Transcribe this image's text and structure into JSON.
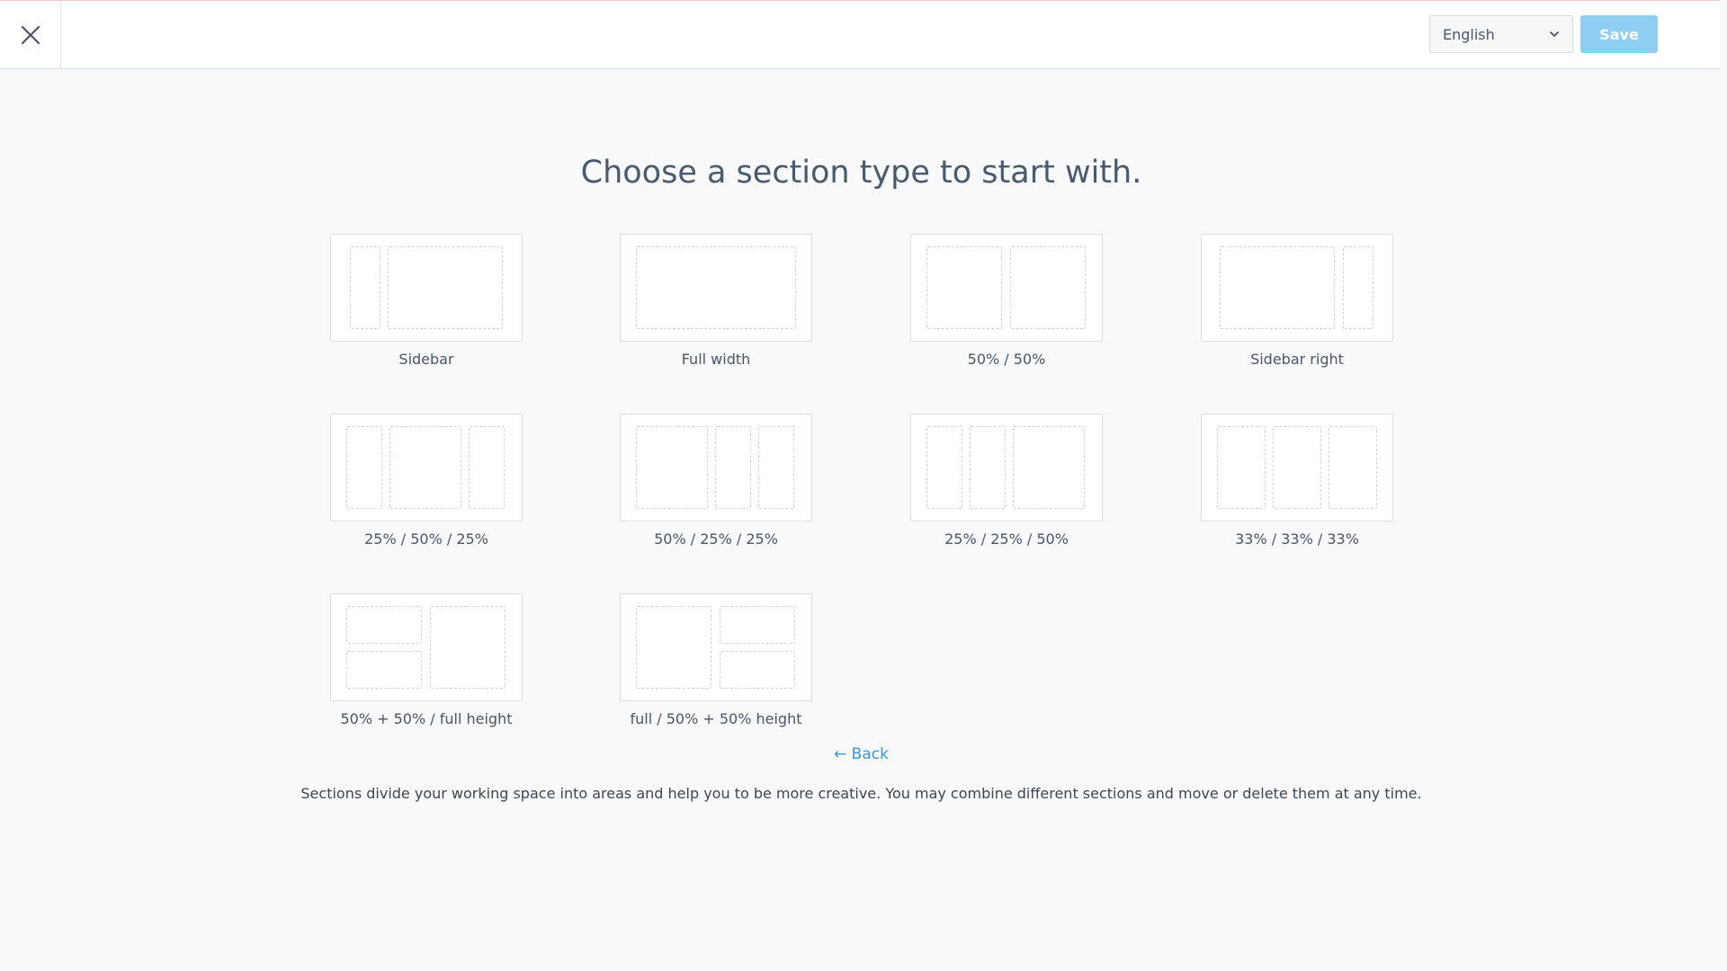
{
  "header": {
    "close_icon": "close-icon",
    "language": {
      "selected": "English",
      "icon": "chevron-down-icon"
    },
    "save_label": "Save"
  },
  "heading": "Choose a section type to start with.",
  "tiles": [
    {
      "label": "Sidebar"
    },
    {
      "label": "Full width"
    },
    {
      "label": "50% / 50%"
    },
    {
      "label": "Sidebar right"
    },
    {
      "label": "25% / 50% / 25%"
    },
    {
      "label": "50% / 25% / 25%"
    },
    {
      "label": "25% / 25% / 50%"
    },
    {
      "label": "33% / 33% / 33%"
    },
    {
      "label": "50% + 50% / full height"
    },
    {
      "label": "full / 50% + 50% height"
    }
  ],
  "back_link": "← Back",
  "footnote": "Sections divide your working space into areas and help you to be more creative. You may combine different sections and move or delete them at any time."
}
